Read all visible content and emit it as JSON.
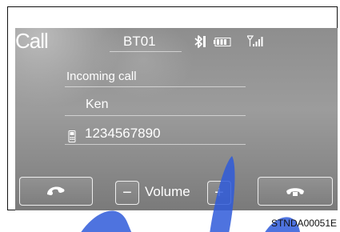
{
  "header": {
    "title": "Call",
    "device_name": "BT01",
    "icons": [
      "bluetooth-icon",
      "battery-icon",
      "signal-strength-icon"
    ]
  },
  "call": {
    "status": "Incoming call",
    "caller_name": "Ken",
    "caller_number": "1234567890"
  },
  "controls": {
    "answer_icon": "phone-answer-icon",
    "decline_icon": "phone-hangup-icon",
    "volume_minus": "−",
    "volume_label": "Volume",
    "volume_plus": "+"
  },
  "figure_code": "STNDA00051E",
  "colors": {
    "screen_bg": "#8e8e8e",
    "text": "#ffffff"
  }
}
